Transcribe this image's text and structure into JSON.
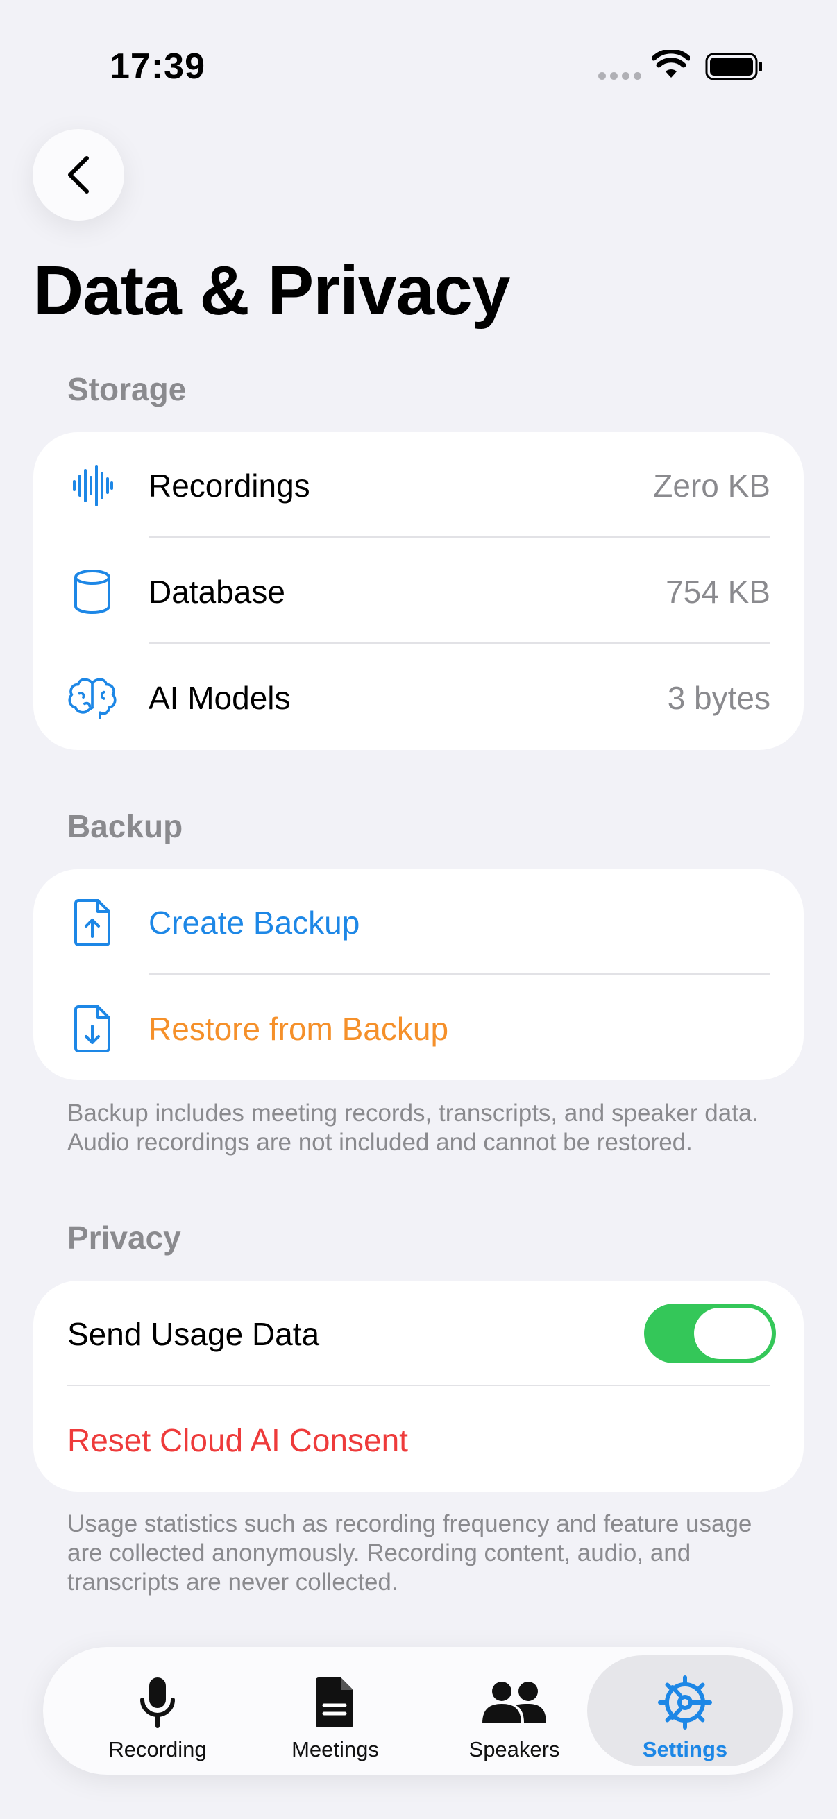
{
  "status_bar": {
    "time": "17:39"
  },
  "page": {
    "title": "Data & Privacy"
  },
  "storage": {
    "header": "Storage",
    "rows": [
      {
        "icon": "waveform-icon",
        "label": "Recordings",
        "value": "Zero KB"
      },
      {
        "icon": "database-icon",
        "label": "Database",
        "value": "754 KB"
      },
      {
        "icon": "brain-icon",
        "label": "AI Models",
        "value": "3 bytes"
      }
    ]
  },
  "backup": {
    "header": "Backup",
    "create_label": "Create Backup",
    "restore_label": "Restore from Backup",
    "footnote": "Backup includes meeting records, transcripts, and speaker data. Audio recordings are not included and cannot be restored."
  },
  "privacy": {
    "header": "Privacy",
    "send_usage_label": "Send Usage Data",
    "send_usage_enabled": true,
    "reset_label": "Reset Cloud AI Consent",
    "footnote": "Usage statistics such as recording frequency and feature usage are collected anonymously. Recording content, audio, and transcripts are never collected."
  },
  "tabs": [
    {
      "label": "Recording",
      "icon": "microphone-icon",
      "active": false
    },
    {
      "label": "Meetings",
      "icon": "document-icon",
      "active": false
    },
    {
      "label": "Speakers",
      "icon": "people-icon",
      "active": false
    },
    {
      "label": "Settings",
      "icon": "gear-icon",
      "active": true
    }
  ],
  "colors": {
    "accent_blue": "#1d87e6",
    "restore_orange": "#f5902a",
    "destructive_red": "#ee3b3b",
    "toggle_green": "#34c759",
    "background": "#f2f2f7"
  }
}
